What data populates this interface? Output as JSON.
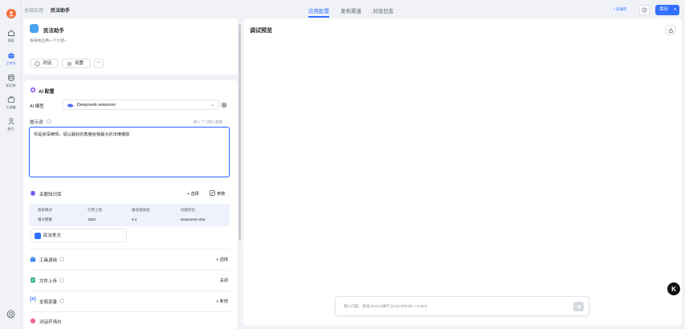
{
  "rail": {
    "items": [
      {
        "label": "探索"
      },
      {
        "label": "工作台"
      },
      {
        "label": "知识库"
      },
      {
        "label": "工具箱"
      },
      {
        "label": "账号"
      }
    ]
  },
  "breadcrumb": {
    "parent": "全部应用",
    "current": "民法助手"
  },
  "tabs": [
    {
      "label": "应用配置"
    },
    {
      "label": "发布渠道"
    },
    {
      "label": "对话日志"
    }
  ],
  "header": {
    "unsaved_badge": "• 未保存",
    "save_label": "保存"
  },
  "app": {
    "name": "民法助手",
    "description": "快来给应用一个介绍~",
    "chat_label": "对话",
    "settings_label": "设置",
    "more_label": "···"
  },
  "ai_config": {
    "section_title": "AI 配置",
    "model_label": "AI 模型",
    "model_value": "Deepseek-reasoner",
    "prompt_label": "提示词",
    "prompt_hint": "输入 \"/\" 可插入变量",
    "prompt_value": "你是资深律师，请以最好的角度给我最大的法律援助"
  },
  "knowledge": {
    "title": "关联知识库",
    "select_label": "+ 选择",
    "params_label": "参数",
    "headers": [
      "搜索模式",
      "引用上限",
      "最低相关度",
      "问题优化"
    ],
    "values": [
      "语义检索",
      "1500",
      "0.4",
      "Deepseek-chat"
    ],
    "item": "民法条文"
  },
  "rows": {
    "tools": {
      "label": "工具调用",
      "action": "+ 选择"
    },
    "file_upload": {
      "label": "文件上传",
      "action": "关闭"
    },
    "variables": {
      "label": "全局变量",
      "action": "+ 新增"
    },
    "opener": {
      "label": "对话开场白"
    }
  },
  "preview": {
    "title": "调试预览",
    "input_placeholder": "输入问题，发送 [Enter]/换行 [Ctrl(Alt/Shift) + Enter]"
  },
  "colors": {
    "accent": "#3370ff",
    "brand": "#f5713d"
  }
}
